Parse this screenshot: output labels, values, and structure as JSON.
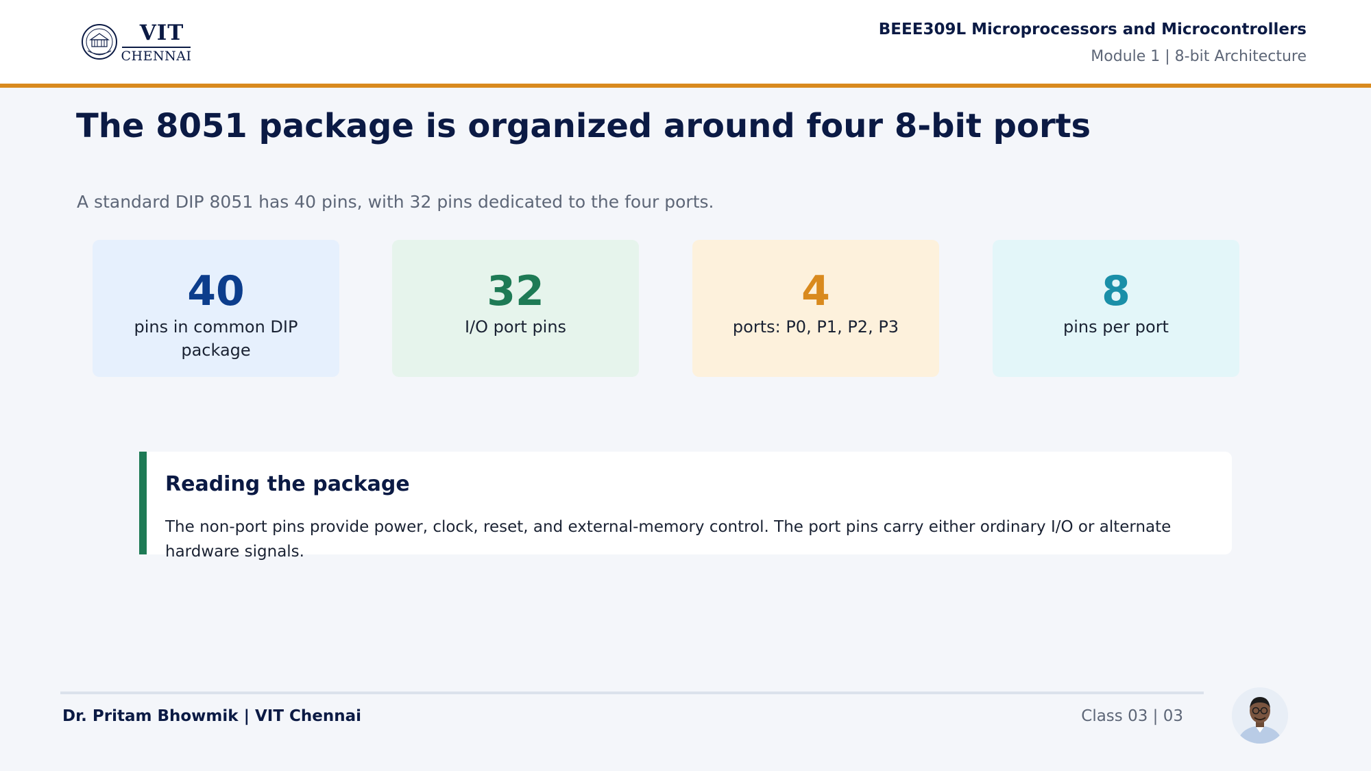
{
  "header": {
    "logo": {
      "name": "VIT",
      "campus": "CHENNAI",
      "seal_icon": "vit-seal-icon"
    },
    "course": "BEEE309L Microprocessors and Microcontrollers",
    "module": "Module 1 | 8-bit Architecture"
  },
  "slide": {
    "title": "The 8051 package is organized around four 8-bit ports",
    "subtitle": "A standard DIP 8051 has 40 pins, with 32 pins dedicated to the four ports.",
    "stats": [
      {
        "value": "40",
        "label": "pins in common DIP package",
        "color": "#0c3d8c",
        "bg": "#e6f0fd"
      },
      {
        "value": "32",
        "label": "I/O port pins",
        "color": "#1e7a55",
        "bg": "#e6f4ec"
      },
      {
        "value": "4",
        "label": "ports: P0, P1, P2, P3",
        "color": "#d98a1e",
        "bg": "#fdf1dc"
      },
      {
        "value": "8",
        "label": "pins per port",
        "color": "#1a8fa8",
        "bg": "#e3f6f9"
      }
    ],
    "callout": {
      "title": "Reading the package",
      "body": "The non-port pins provide power, clock, reset, and external-memory control. The port pins carry either ordinary I/O or alternate hardware signals.",
      "accent": "#1e7a55"
    }
  },
  "footer": {
    "author": "Dr. Pritam Bhowmik | VIT Chennai",
    "page": "Class 03  |  03",
    "avatar_icon": "presenter-avatar-icon"
  },
  "colors": {
    "accent_rule": "#d98a1e",
    "navy": "#0b1a44",
    "background": "#f4f6fa"
  }
}
